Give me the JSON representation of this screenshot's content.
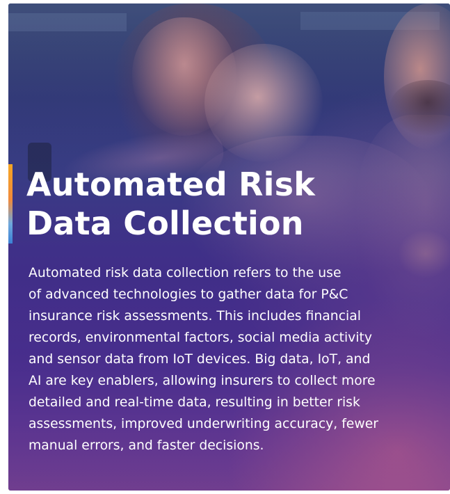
{
  "card": {
    "photo_description_icon": "family-photo",
    "accent_colors": [
      "#f5a623",
      "#3b82d6"
    ],
    "title": "Automated Risk\nData Collection",
    "body": "Automated risk data collection refers to the use\nof advanced technologies to gather data for P&C\ninsurance risk assessments. This includes financial\nrecords, environmental factors, social media  activity\nand sensor data from IoT devices. Big data, IoT, and\nAI are key enablers, allowing insurers to collect more\ndetailed and real-time data, resulting in better risk\nassessments, improved underwriting accuracy, fewer\nmanual errors, and faster decisions."
  }
}
